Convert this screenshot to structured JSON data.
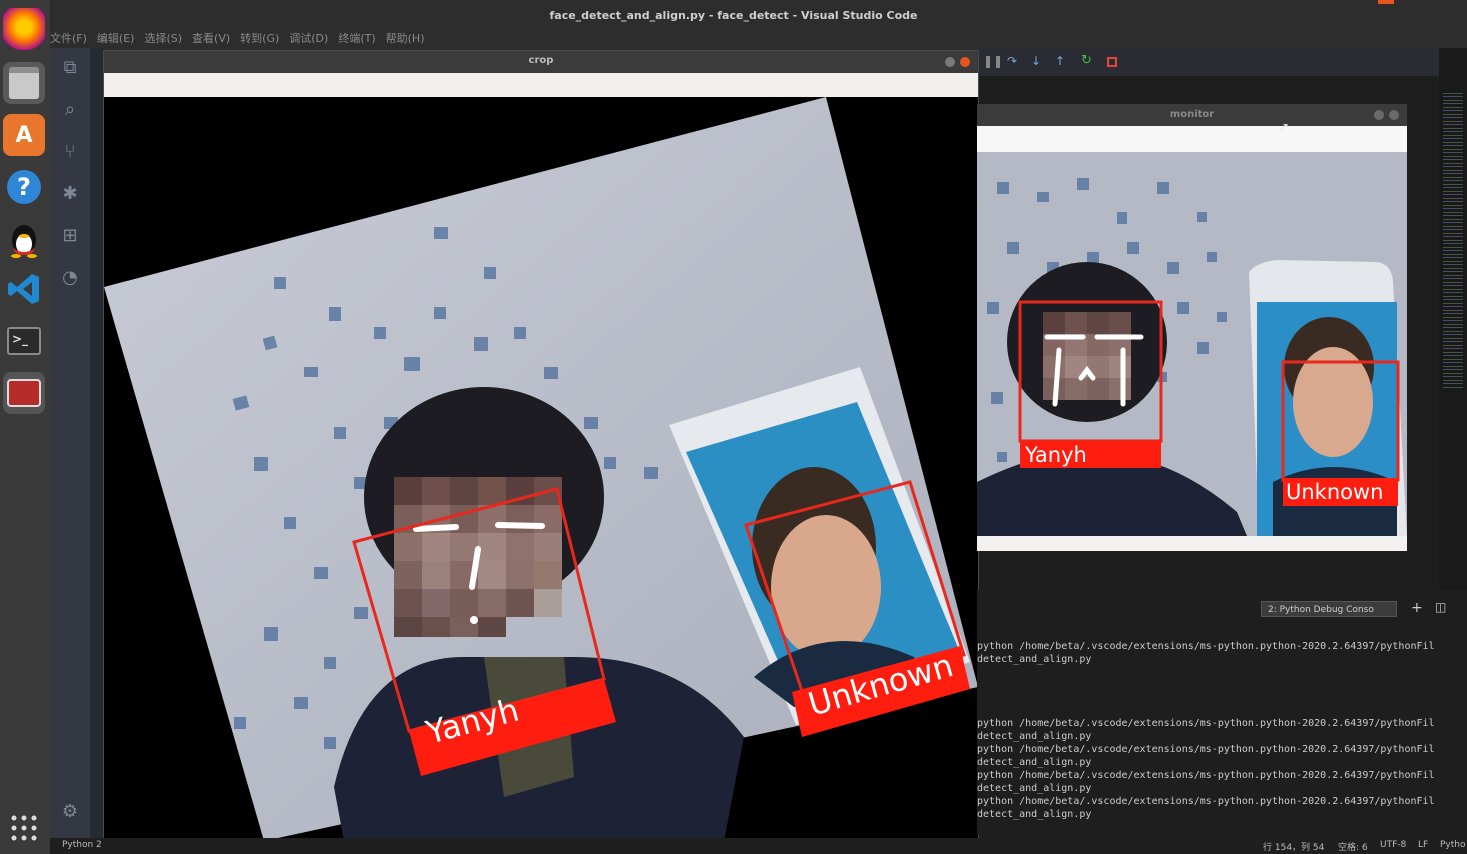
{
  "editor": {
    "window_title": "face_detect_and_align.py - face_detect - Visual Studio Code",
    "menu": [
      "文件(F)",
      "编辑(E)",
      "选择(S)",
      "查看(V)",
      "转到(G)",
      "调试(D)",
      "终端(T)",
      "帮助(H)"
    ]
  },
  "launcher": {
    "icons": [
      "firefox-icon",
      "files-icon",
      "software-center-icon",
      "help-icon",
      "qq-icon",
      "vscode-icon",
      "terminal-icon",
      "recorder-icon"
    ],
    "apps_grid_icon": "apps-grid-icon"
  },
  "crop_window": {
    "title": "crop",
    "label_left": "Yanyh",
    "label_right": "Unknown"
  },
  "monitor_window": {
    "title": "monitor",
    "label_left": "Yanyh",
    "label_right": "Unknown"
  },
  "terminal": {
    "panel_selector": "2: Python Debug Conso",
    "lines": [
      "python /home/beta/.vscode/extensions/ms-python.python-2020.2.64397/pythonFil",
      "detect_and_align.py",
      "",
      "",
      "",
      "python /home/beta/.vscode/extensions/ms-python.python-2020.2.64397/pythonFil",
      "detect_and_align.py",
      "python /home/beta/.vscode/extensions/ms-python.python-2020.2.64397/pythonFil",
      "detect_and_align.py",
      "python /home/beta/.vscode/extensions/ms-python.python-2020.2.64397/pythonFil",
      "detect_and_align.py",
      "python /home/beta/.vscode/extensions/ms-python.python-2020.2.64397/pythonFil",
      "detect_and_align.py"
    ]
  },
  "statusbar": {
    "left": "Python 2",
    "position": "行 154，列 54",
    "spaces": "空格: 6",
    "encoding": "UTF-8",
    "eol": "LF",
    "language": "Pytho"
  },
  "colors": {
    "label_red": "#ff1d0f",
    "box_red": "#e8281c",
    "vscode_blue": "#1f8ad2"
  }
}
